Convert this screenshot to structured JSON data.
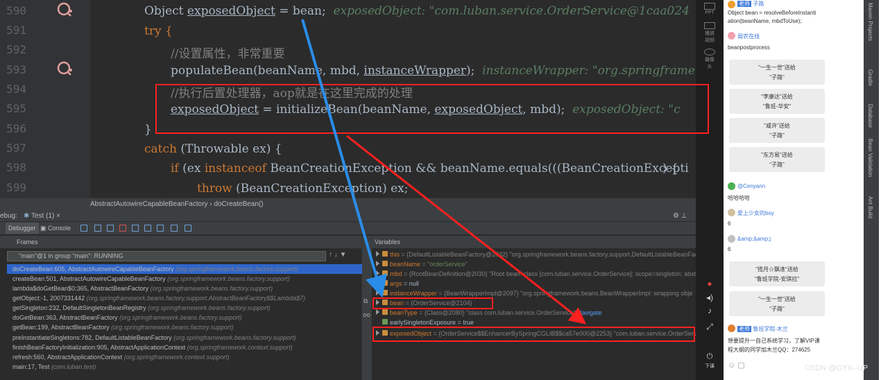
{
  "editor": {
    "line_numbers": [
      "590",
      "591",
      "592",
      "593",
      "594",
      "595",
      "596",
      "597",
      "598",
      "599"
    ],
    "lines": {
      "l590_code": "Object ",
      "l590_var": "exposedObject",
      "l590_rest": " = bean;",
      "l590_hint": "exposedObject: \"com.luban.service.OrderService@1caa024",
      "l591": "try {",
      "l592": "//设置属性，非常重要",
      "l593_code": "populateBean(beanName, mbd, ",
      "l593_var": "instanceWrapper",
      "l593_rest": ");",
      "l593_hint": "instanceWrapper: \"org.springframe",
      "l594": "//执行后置处理器，aop就是在这里完成的处理",
      "l595_var": "exposedObject",
      "l595_mid": " = initializeBean(beanName, ",
      "l595_var2": "exposedObject",
      "l595_rest": ", mbd);",
      "l595_hint": "exposedObject: \"c",
      "l596": "}",
      "l597_kw": "catch",
      "l597_rest": " (Throwable ex) {",
      "l598_kw": "if",
      "l598_rest": " (ex ",
      "l598_kw2": "instanceof",
      "l598_rest2": " BeanCreationException && beanName.equals(((BeanCreationExcepti",
      "l598_tail": ") {",
      "l599_kw": "throw",
      "l599_rest": " (BeanCreationException) ex;"
    }
  },
  "breadcrumb": {
    "class": "AbstractAutowireCapableBeanFactory",
    "sep": "›",
    "method": "doCreateBean()"
  },
  "debug_panel": {
    "title_prefix": "ebug:",
    "run_tab": "Test (1)",
    "tabs": {
      "debugger": "Debugger",
      "console": "Console"
    },
    "frames_header": "Frames",
    "variables_header": "Variables",
    "thread_selector": "\"main\"@1 in group \"main\": RUNNING"
  },
  "frames": [
    {
      "method": "doCreateBean:605, AbstractAutowireCapableBeanFactory",
      "pkg": "(org.springframework.beans.factory.support)"
    },
    {
      "method": "createBean:501, AbstractAutowireCapableBeanFactory",
      "pkg": "(org.springframework.beans.factory.support)"
    },
    {
      "method": "lambda$doGetBean$0:365, AbstractBeanFactory",
      "pkg": "(org.springframework.beans.factory.support)"
    },
    {
      "method": "getObject:-1, 2007331442",
      "pkg": "(org.springframework.beans.factory.support.AbstractBeanFactory$$Lambda$7)"
    },
    {
      "method": "getSingleton:232, DefaultSingletonBeanRegistry",
      "pkg": "(org.springframework.beans.factory.support)"
    },
    {
      "method": "doGetBean:363, AbstractBeanFactory",
      "pkg": "(org.springframework.beans.factory.support)"
    },
    {
      "method": "getBean:199, AbstractBeanFactory",
      "pkg": "(org.springframework.beans.factory.support)"
    },
    {
      "method": "preInstantiateSingletons:782, DefaultListableBeanFactory",
      "pkg": "(org.springframework.beans.factory.support)"
    },
    {
      "method": "finishBeanFactoryInitialization:905, AbstractApplicationContext",
      "pkg": "(org.springframework.context.support)"
    },
    {
      "method": "refresh:560, AbstractApplicationContext",
      "pkg": "(org.springframework.context.support)"
    },
    {
      "method": "main:17, Test",
      "pkg": "(com.luban.test)"
    }
  ],
  "variables": [
    {
      "name": "this",
      "value": "= {DefaultListableBeanFactory@2032} \"org.springframework.beans.factory.support.DefaultListableBeanFacto"
    },
    {
      "name": "beanName",
      "value": "= \"orderService\""
    },
    {
      "name": "mbd",
      "value": "= {RootBeanDefinition@2030} \"Root bean: class [com.luban.service.OrderService]; scope=singleton; abstr"
    },
    {
      "name": "args",
      "value": "= null"
    },
    {
      "name": "instanceWrapper",
      "value": "= {BeanWrapperImpl@2097} \"org.springframework.beans.BeanWrapperImpl: wrapping obje"
    },
    {
      "name": "bean",
      "value": "= {OrderService@2104}"
    },
    {
      "name": "beanType",
      "value": "= {Class@2080} \"class com.luban.service.OrderService\"",
      "link": "Navigate"
    },
    {
      "name": "earlySingletonExposure",
      "value": "= true"
    },
    {
      "name": "exposedObject",
      "value": "= {OrderService$$EnhancerBySpringCGLIB$$ca57e000@2253} \"com.luban.service.OrderService"
    }
  ],
  "side_tools": [
    "PPT",
    "播放视频",
    "摄像头"
  ],
  "side_bottom": "下课",
  "ide_right_tools": [
    "Maven Projects",
    "Gradle",
    "Database",
    "Bean Validation",
    "Ant Build"
  ],
  "chat": {
    "top_name": "子路",
    "top_text1": "Object bean = resolveBeforeInstanti",
    "top_text2": "ation(beanName, mbdToUse);",
    "msg1_name": "弱农在线",
    "msg1_text": "beanpostprocess",
    "gifts": [
      {
        "line1": "\"一生一世\"送给",
        "line2": "\"子路\""
      },
      {
        "line1": "\"李康达\"送给",
        "line2": "\"鲁班-华安\""
      },
      {
        "line1": "\"咸许\"送给",
        "line2": "\"子路\""
      },
      {
        "line1": "\"东方易\"送给",
        "line2": "\"子路\""
      }
    ],
    "msg2_name": "@Cenyann",
    "msg2_text": "哈哈哈哈",
    "msg3_name": "爱上少女的boy",
    "msg3_text": "6",
    "msg4_name": "&amp;&amp;j",
    "msg4_text": "6",
    "gifts2": [
      {
        "line1": "\"揽月☆飘逢\"送给",
        "line2": "\"鲁班学院-安琪拉\""
      },
      {
        "line1": "\"一生一世\"送给",
        "line2": "\"子路\""
      }
    ],
    "msg5_badge": "老师",
    "msg5_name": "鲁班学院-木兰",
    "msg5_text1": "想要提升一自己系统学习，了解VIP课",
    "msg5_text2": "程大纲的同学加木兰QQ：274625",
    "top_badge": "老师"
  },
  "watermark": "CSDN @GYX--UP",
  "colors": {
    "annotation_red": "#ff2020",
    "annotation_blue": "#2a8de8",
    "selection": "#2f65ca"
  }
}
